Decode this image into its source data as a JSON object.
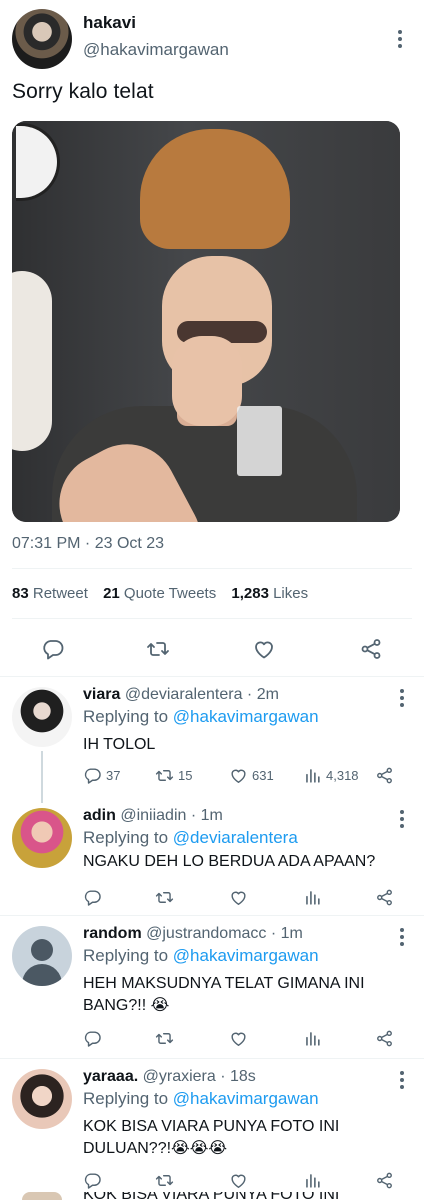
{
  "tweet": {
    "name": "hakavi",
    "handle": "@hakavimargawan",
    "text": "Sorry kalo telat",
    "timestamp": "07:31 PM · 23 Oct 23",
    "stats": {
      "retweets": "83",
      "retweets_label": "Retweet",
      "quotes": "21",
      "quotes_label": "Quote Tweets",
      "likes": "1,283",
      "likes_label": "Likes"
    }
  },
  "replies": [
    {
      "name": "viara",
      "handle": "@deviaralentera",
      "time": "· 2m",
      "replying_prefix": "Replying to",
      "replying_to": "@hakavimargawan",
      "text": "IH TOLOL",
      "replies": "37",
      "retweets": "15",
      "likes": "631",
      "views": "4,318"
    },
    {
      "name": "adin",
      "handle": "@iniiadin",
      "time": "· 1m",
      "replying_prefix": "Replying to",
      "replying_to": "@deviaralentera",
      "text": "NGAKU DEH LO BERDUA ADA APAAN?",
      "replies": "",
      "retweets": "",
      "likes": "",
      "views": ""
    },
    {
      "name": "random",
      "handle": "@justrandomacc",
      "time": "· 1m",
      "replying_prefix": "Replying to",
      "replying_to": "@hakavimargawan",
      "text": "HEH MAKSUDNYA TELAT GIMANA INI BANG?!! 😭",
      "replies": "",
      "retweets": "",
      "likes": "",
      "views": ""
    },
    {
      "name": "yaraaa.",
      "handle": "@yraxiera",
      "time": "· 18s",
      "replying_prefix": "Replying to",
      "replying_to": "@hakavimargawan",
      "text": "KOK BISA VIARA PUNYA FOTO INI DULUAN??!😭😭😭",
      "replies": "",
      "retweets": "",
      "likes": "",
      "views": ""
    }
  ],
  "partial_text": "KOK BISA VIARA PUNYA FOTO INI",
  "icons": [
    "reply-icon",
    "retweet-icon",
    "like-icon",
    "share-icon",
    "views-icon",
    "more-icon"
  ],
  "colors": {
    "accent": "#1d9bf0",
    "muted": "#536471",
    "text": "#0f1419",
    "divider": "#eff3f4"
  }
}
